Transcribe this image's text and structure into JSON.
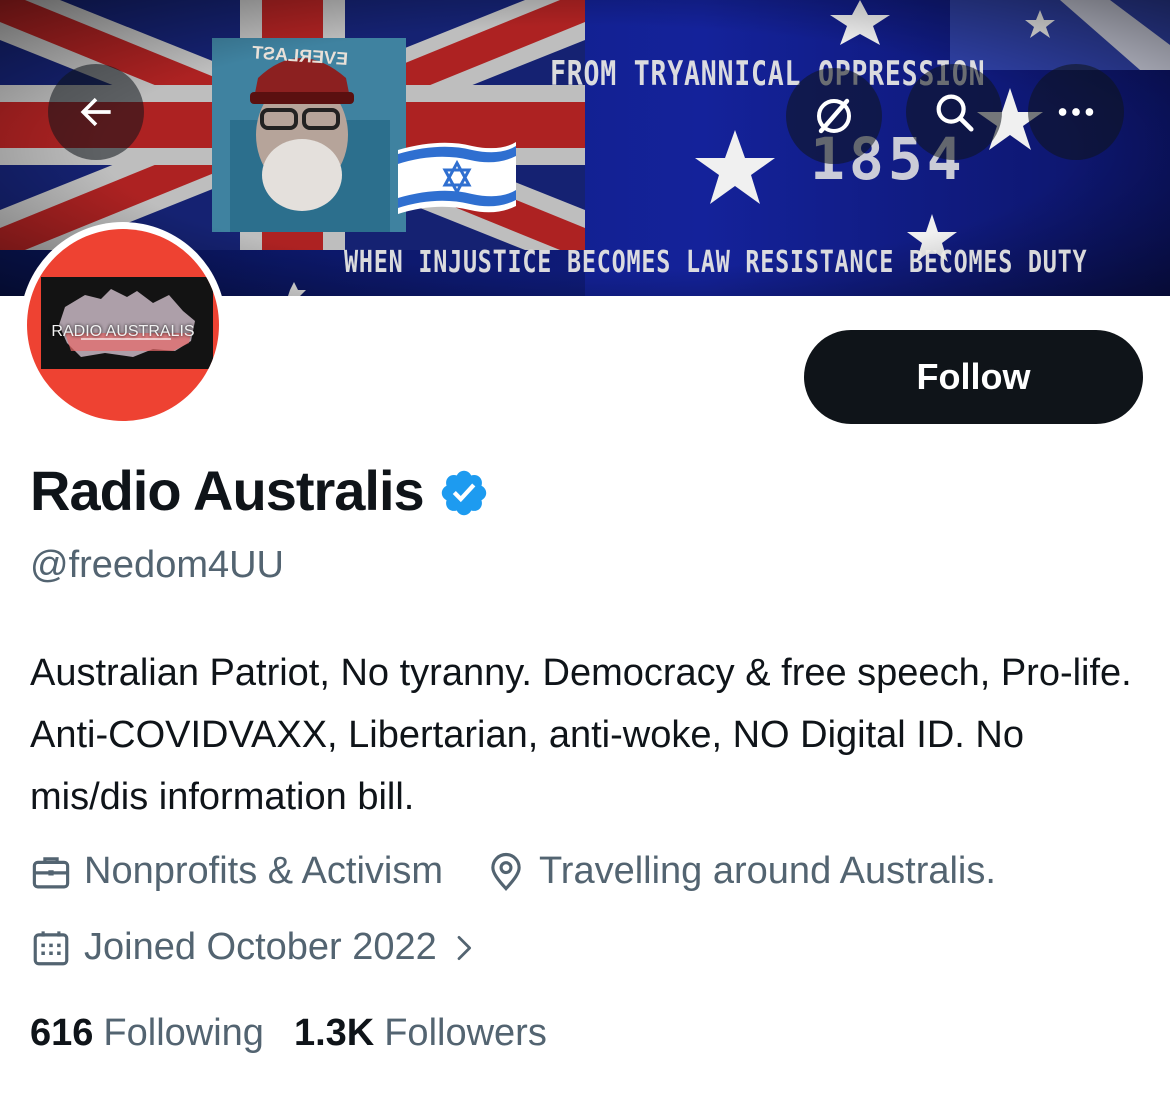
{
  "banner": {
    "top_text": "FROM TRYANNICAL OPPRESSION",
    "year_text": "1854",
    "bottom_text": "WHEN INJUSTICE BECOMES LAW RESISTANCE BECOMES DUTY",
    "cap_text": "EVERLAST"
  },
  "header_icons": {
    "back": "arrow-left-icon",
    "notify": "bell-slash-icon",
    "search": "search-icon",
    "more": "more-horizontal-icon"
  },
  "avatar": {
    "label": "RADIO AUSTRALIS",
    "ring_color": "#ee4232"
  },
  "follow_button": {
    "label": "Follow"
  },
  "profile": {
    "name": "Radio Australis",
    "verified": true,
    "verified_color": "#1d9bf0",
    "handle": "@freedom4UU",
    "bio": "Australian Patriot, No tyranny. Democracy & free speech, Pro-life. Anti-COVIDVAXX, Libertarian, anti-woke, NO Digital ID. No mis/dis information bill.",
    "category": "Nonprofits & Activism",
    "location": "Travelling around Australis.",
    "joined": "Joined October 2022"
  },
  "stats": {
    "following_count": "616",
    "following_label": "Following",
    "followers_count": "1.3K",
    "followers_label": "Followers"
  },
  "colors": {
    "text_primary": "#0f1419",
    "text_secondary": "#536471",
    "button_bg": "#0f1419"
  }
}
